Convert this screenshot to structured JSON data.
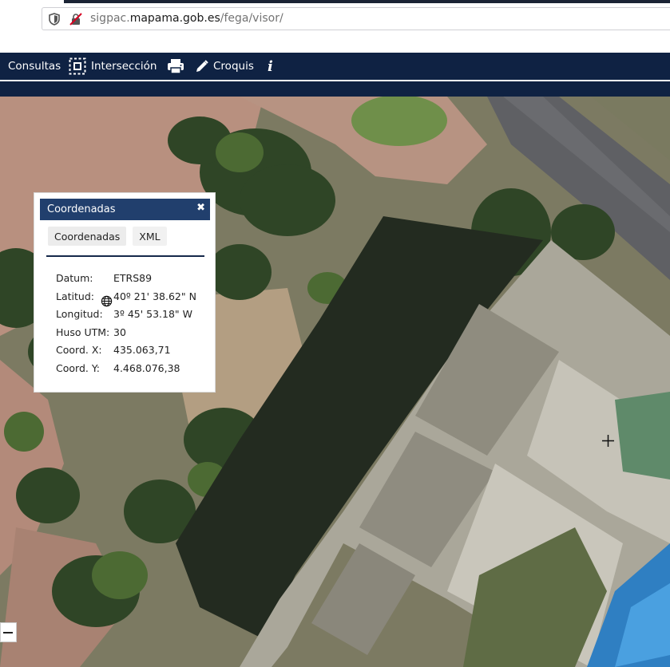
{
  "browser": {
    "url_host_prefix": "sigpac.",
    "url_host": "mapama.gob.es",
    "url_path": "/fega/visor/"
  },
  "toolbar": {
    "consultas_label": "Consultas",
    "interseccion_label": "Intersección",
    "print_icon": "printer-icon",
    "croquis_label": "Croquis",
    "info_label": "i"
  },
  "panel": {
    "title": "Coordenadas",
    "close_label": "✖",
    "tabs": [
      "Coordenadas",
      "XML"
    ],
    "rows": [
      {
        "label": "Datum:",
        "value": "ETRS89"
      },
      {
        "label": "Latitud:",
        "value": "40º 21' 38.62\" N"
      },
      {
        "label": "Longitud:",
        "value": "3º 45' 53.18\" W"
      },
      {
        "label": "Huso UTM:",
        "value": "30"
      },
      {
        "label": "Coord. X:",
        "value": "435.063,71"
      },
      {
        "label": "Coord. Y:",
        "value": "4.468.076,38"
      }
    ]
  },
  "colors": {
    "toolbar_bg": "#0f2243",
    "panel_header": "#213f6d"
  }
}
